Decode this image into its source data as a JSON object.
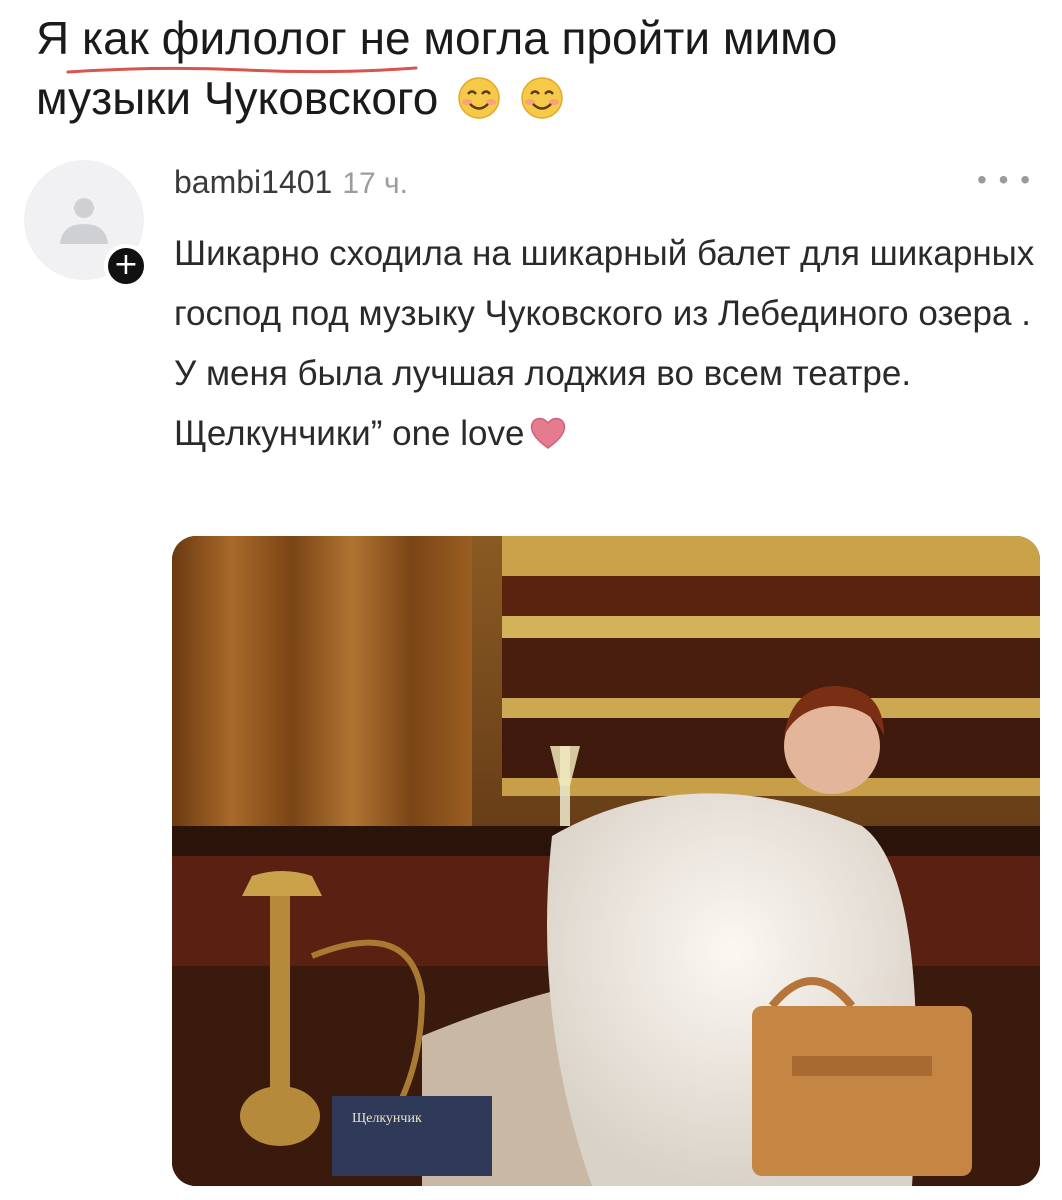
{
  "caption": {
    "line1": "Я как филолог не могла пройти мимо",
    "line2": "музыки Чуковского",
    "emojis": [
      "smiling-face-icon",
      "smiling-face-icon"
    ]
  },
  "post": {
    "username": "bambi1401",
    "time": "17 ч.",
    "more_icon": "more-icon",
    "follow_icon": "plus-icon",
    "text_lines": [
      "Шикарно сходила на шикарный балет для шикарных господ под музыку Чуковского из Лебединого озера .",
      "У меня была лучшая лоджия во всем театре.",
      "Щелкунчики” one love"
    ],
    "heart_icon": "heart-icon",
    "photo": {
      "book_title": "Щелкунчик"
    }
  },
  "colors": {
    "underline": "#d9534f",
    "text": "#2a2a2a",
    "muted": "#9c9c9c",
    "heart": "#e57b8f"
  }
}
